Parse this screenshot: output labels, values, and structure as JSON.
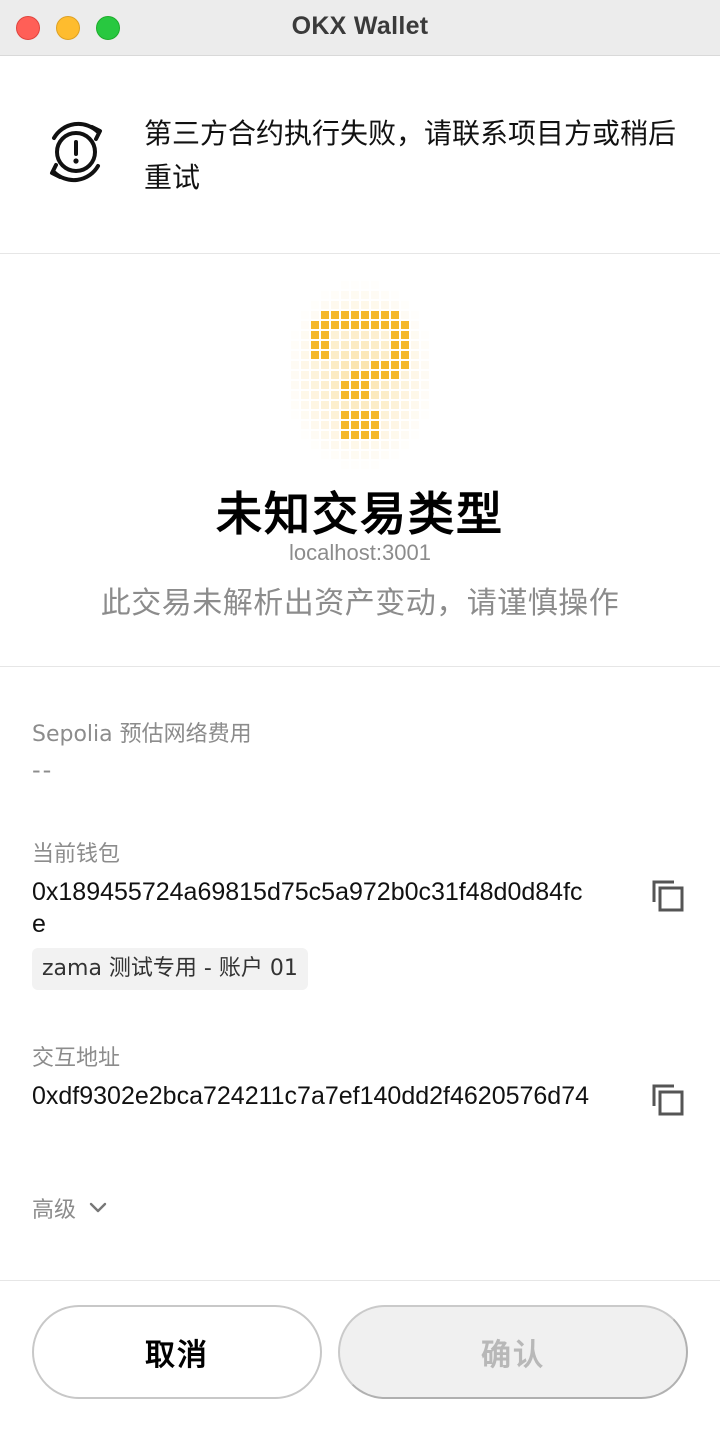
{
  "window": {
    "title": "OKX Wallet"
  },
  "alert": {
    "icon": "refresh-alert-icon",
    "message": "第三方合约执行失败，请联系项目方或稍后重试"
  },
  "hero": {
    "icon": "pixel-question-mark-icon",
    "accent_color": "#f5b829",
    "tx_type": "未知交易类型",
    "origin": "localhost:3001",
    "warning": "此交易未解析出资产变动，请谨慎操作"
  },
  "fee": {
    "label": "Sepolia 预估网络费用",
    "value": "--"
  },
  "wallet": {
    "label": "当前钱包",
    "address": "0x189455724a69815d75c5a972b0c31f48d0d84fce",
    "account_tag": "zama 测试专用 - 账户 01",
    "copy_icon": "copy-icon"
  },
  "contract": {
    "label": "交互地址",
    "address": "0xdf9302e2bca724211c7a7ef140dd2f4620576d74",
    "copy_icon": "copy-icon"
  },
  "advanced": {
    "label": "高级",
    "icon": "chevron-down-icon"
  },
  "actions": {
    "cancel_label": "取消",
    "confirm_label": "确认"
  }
}
